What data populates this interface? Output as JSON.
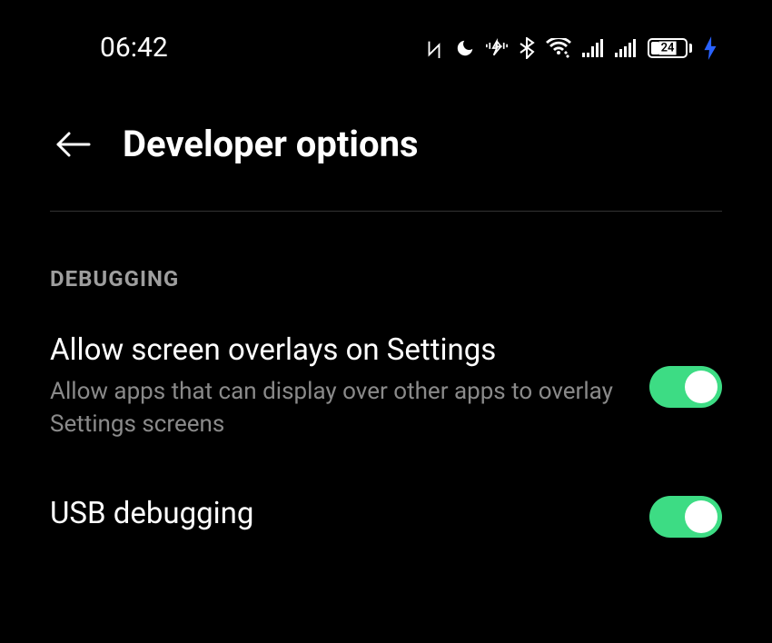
{
  "statusBar": {
    "time": "06:42",
    "batteryPercent": "24"
  },
  "header": {
    "title": "Developer options"
  },
  "section": {
    "header": "DEBUGGING"
  },
  "settings": {
    "overlays": {
      "title": "Allow screen overlays on Settings",
      "subtitle": "Allow apps that can display over other apps to overlay Settings screens",
      "enabled": true
    },
    "usbDebugging": {
      "title": "USB debugging",
      "enabled": true
    }
  }
}
